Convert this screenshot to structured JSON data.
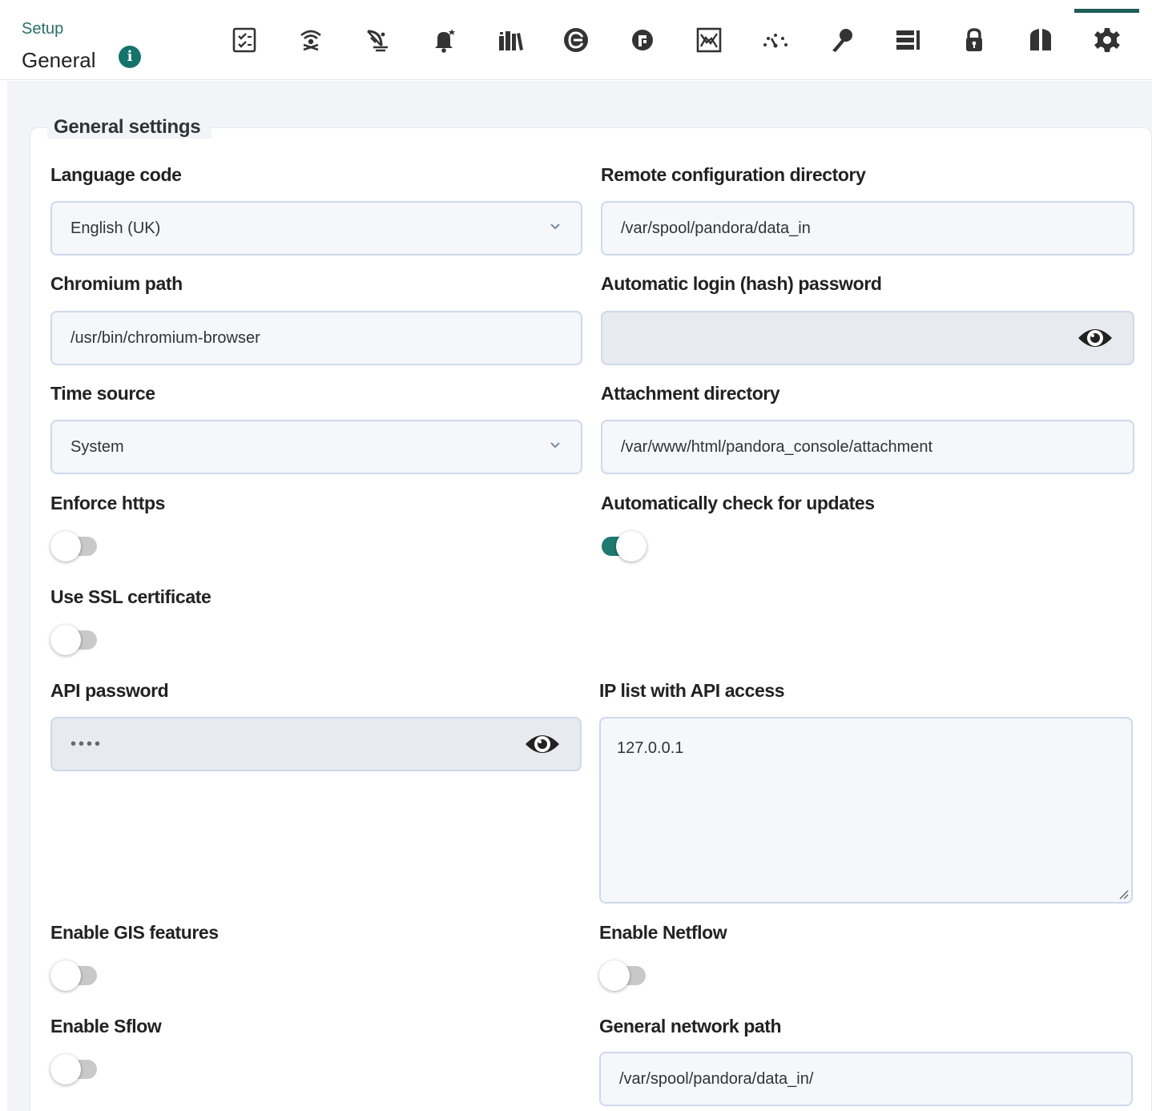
{
  "header": {
    "breadcrumb": "Setup",
    "title": "General",
    "tabs": [
      {
        "icon": "checklist-icon",
        "active": false
      },
      {
        "icon": "wireless-tower-icon",
        "active": false
      },
      {
        "icon": "satellite-dish-icon",
        "active": false
      },
      {
        "icon": "bell-icon",
        "active": false
      },
      {
        "icon": "library-icon",
        "active": false
      },
      {
        "icon": "enterprise-logo-icon",
        "active": false
      },
      {
        "icon": "open-logo-icon",
        "active": false
      },
      {
        "icon": "chart-box-icon",
        "active": false
      },
      {
        "icon": "gauge-icon",
        "active": false
      },
      {
        "icon": "key-icon",
        "active": false
      },
      {
        "icon": "server-stack-icon",
        "active": false
      },
      {
        "icon": "lock-icon",
        "active": false
      },
      {
        "icon": "split-columns-icon",
        "active": false
      },
      {
        "icon": "gear-icon",
        "active": true
      }
    ]
  },
  "settings": {
    "legend": "General settings",
    "language_code": {
      "label": "Language code",
      "value": "English (UK)"
    },
    "remote_config_dir": {
      "label": "Remote configuration directory",
      "value": "/var/spool/pandora/data_in"
    },
    "chromium_path": {
      "label": "Chromium path",
      "value": "/usr/bin/chromium-browser"
    },
    "auto_login_password": {
      "label": "Automatic login (hash) password",
      "value": ""
    },
    "time_source": {
      "label": "Time source",
      "value": "System"
    },
    "attachment_dir": {
      "label": "Attachment directory",
      "value": "/var/www/html/pandora_console/attachment"
    },
    "enforce_https": {
      "label": "Enforce https",
      "enabled": false
    },
    "auto_check_updates": {
      "label": "Automatically check for updates",
      "enabled": true
    },
    "use_ssl_cert": {
      "label": "Use SSL certificate",
      "enabled": false
    },
    "api_password": {
      "label": "API password",
      "value": "••••"
    },
    "ip_list_api": {
      "label": "IP list with API access",
      "value": "127.0.0.1"
    },
    "enable_gis": {
      "label": "Enable GIS features",
      "enabled": false
    },
    "enable_netflow": {
      "label": "Enable Netflow",
      "enabled": false
    },
    "enable_sflow": {
      "label": "Enable Sflow",
      "enabled": false
    },
    "general_network_path": {
      "label": "General network path",
      "value": "/var/spool/pandora/data_in/"
    }
  },
  "colors": {
    "accent": "#1e7a70",
    "tab_indicator": "#1e5e5a",
    "toggle_off": "#c9c9c9"
  }
}
